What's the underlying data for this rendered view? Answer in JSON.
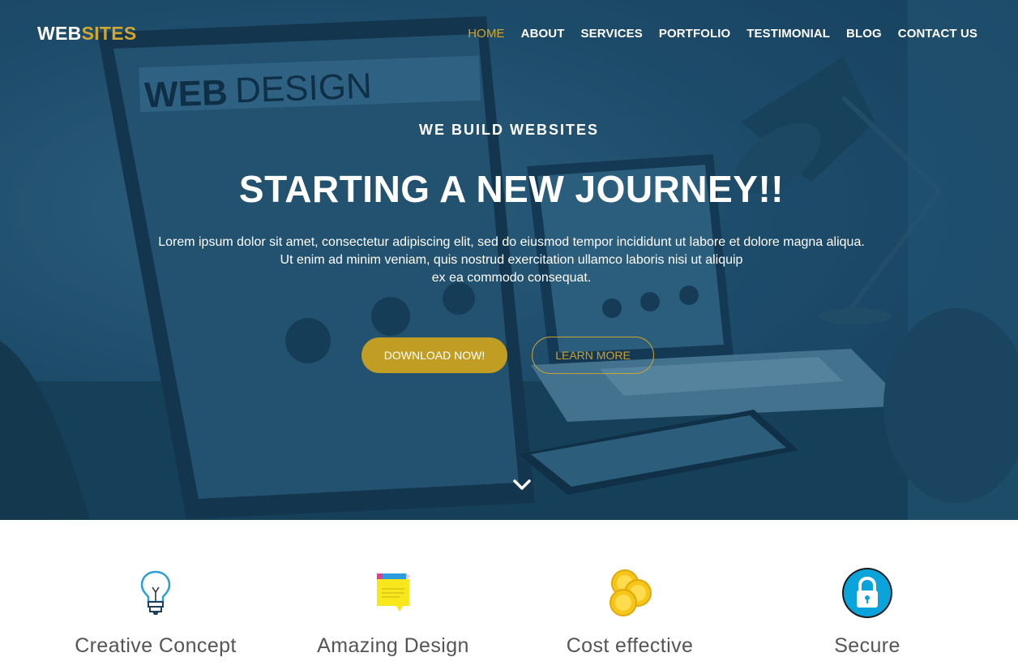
{
  "brand": {
    "part1": "WEB",
    "part2": "SITES"
  },
  "nav": {
    "items": [
      {
        "label": "HOME"
      },
      {
        "label": "ABOUT"
      },
      {
        "label": "SERVICES"
      },
      {
        "label": "PORTFOLIO"
      },
      {
        "label": "TESTIMONIAL"
      },
      {
        "label": "BLOG"
      },
      {
        "label": "CONTACT US"
      }
    ]
  },
  "hero": {
    "kicker": "WE BUILD WEBSITES",
    "headline": "STARTING A NEW JOURNEY!!",
    "lede_line1": "Lorem ipsum dolor sit amet, consectetur adipiscing elit, sed do eiusmod tempor incididunt ut labore et dolore magna aliqua.",
    "lede_line2": "Ut enim ad minim veniam, quis nostrud exercitation ullamco laboris nisi ut aliquip",
    "lede_line3": "ex ea commodo consequat.",
    "primary_button": "DOWNLOAD NOW!",
    "secondary_button": "LEARN MORE",
    "screen_text": {
      "brand_a": "WEB",
      "brand_b": "DESIGN"
    }
  },
  "features": [
    {
      "title": "Creative Concept",
      "icon": "lightbulb-icon"
    },
    {
      "title": "Amazing Design",
      "icon": "sticky-note-icon"
    },
    {
      "title": "Cost effective",
      "icon": "coins-icon"
    },
    {
      "title": "Secure",
      "icon": "lock-icon"
    }
  ],
  "colors": {
    "accent": "#c29d24",
    "hero_overlay": "#1e4f6b",
    "feature_text": "#555555"
  }
}
